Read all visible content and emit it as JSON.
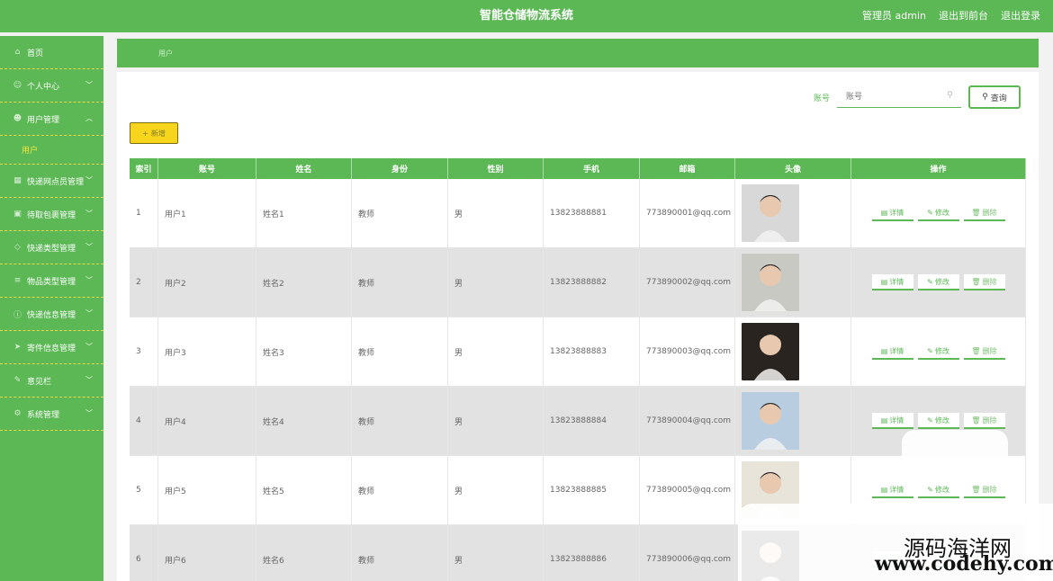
{
  "header": {
    "title": "智能仓储物流系统",
    "user": "管理员 admin",
    "to_front": "退出到前台",
    "logout": "退出登录"
  },
  "sidebar": {
    "items": [
      {
        "label": "首页",
        "icon": "home-icon",
        "expandable": false
      },
      {
        "label": "个人中心",
        "icon": "person-icon",
        "expandable": true
      },
      {
        "label": "用户管理",
        "icon": "users-icon",
        "expandable": true,
        "open": true
      },
      {
        "label": "快递网点员管理",
        "icon": "grid-icon",
        "expandable": true
      },
      {
        "label": "待取包裹管理",
        "icon": "box-icon",
        "expandable": true
      },
      {
        "label": "快递类型管理",
        "icon": "tag-icon",
        "expandable": true
      },
      {
        "label": "物品类型管理",
        "icon": "list-icon",
        "expandable": true
      },
      {
        "label": "快递信息管理",
        "icon": "info-icon",
        "expandable": true
      },
      {
        "label": "寄件信息管理",
        "icon": "send-icon",
        "expandable": true
      },
      {
        "label": "意见栏",
        "icon": "chat-icon",
        "expandable": true
      },
      {
        "label": "系统管理",
        "icon": "gear-icon",
        "expandable": true
      }
    ],
    "sub_active": "用户"
  },
  "breadcrumb": "用户",
  "search": {
    "label": "账号",
    "placeholder": "账号",
    "button": "查询"
  },
  "add_button": "新增",
  "table": {
    "headers": [
      "索引",
      "账号",
      "姓名",
      "身份",
      "性别",
      "手机",
      "邮箱",
      "头像",
      "操作"
    ],
    "rows": [
      {
        "index": "1",
        "account": "用户1",
        "name": "姓名1",
        "role": "教师",
        "gender": "男",
        "phone": "13823888881",
        "email": "773890001@qq.com",
        "avatar_color": "#d8d8d8"
      },
      {
        "index": "2",
        "account": "用户2",
        "name": "姓名2",
        "role": "教师",
        "gender": "男",
        "phone": "13823888882",
        "email": "773890002@qq.com",
        "avatar_color": "#c9c9c4"
      },
      {
        "index": "3",
        "account": "用户3",
        "name": "姓名3",
        "role": "教师",
        "gender": "男",
        "phone": "13823888883",
        "email": "773890003@qq.com",
        "avatar_color": "#2a2420"
      },
      {
        "index": "4",
        "account": "用户4",
        "name": "姓名4",
        "role": "教师",
        "gender": "男",
        "phone": "13823888884",
        "email": "773890004@qq.com",
        "avatar_color": "#b9cde0"
      },
      {
        "index": "5",
        "account": "用户5",
        "name": "姓名5",
        "role": "教师",
        "gender": "男",
        "phone": "13823888885",
        "email": "773890005@qq.com",
        "avatar_color": "#e9e4da"
      },
      {
        "index": "6",
        "account": "用户6",
        "name": "姓名6",
        "role": "教师",
        "gender": "男",
        "phone": "13823888886",
        "email": "773890006@qq.com",
        "avatar_color": "#2e2a28"
      }
    ],
    "actions": {
      "detail": "详情",
      "edit": "修改",
      "delete": "删除"
    }
  },
  "watermark": {
    "text": "源码海洋网",
    "url": "www.codehy.com"
  },
  "colors": {
    "primary": "#5bb855",
    "accent": "#f7d51d"
  }
}
